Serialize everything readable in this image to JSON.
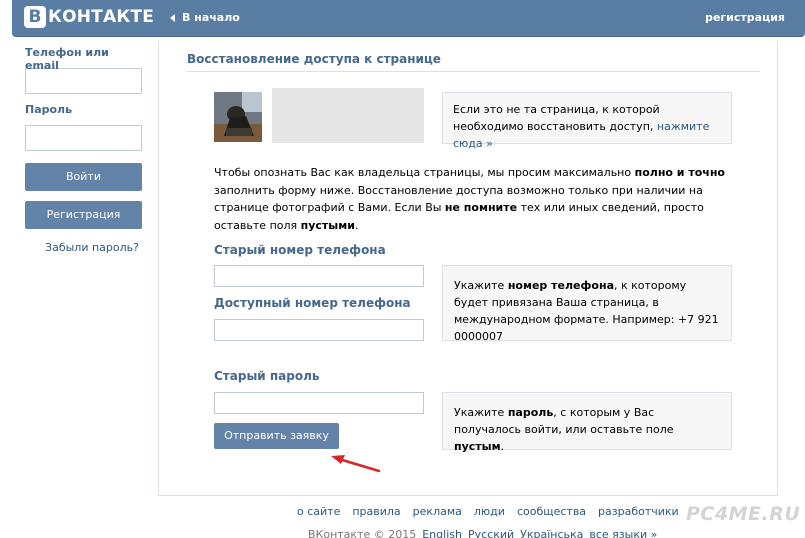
{
  "header": {
    "logo_letter": "В",
    "logo_text": "КОНТАКТЕ",
    "home_link": "В начало",
    "register_link": "регистрация"
  },
  "sidebar": {
    "login_label": "Телефон или email",
    "login_value": "",
    "password_label": "Пароль",
    "password_value": "",
    "login_button": "Войти",
    "register_button": "Регистрация",
    "forgot_link": "Забыли пароль?"
  },
  "main": {
    "title": "Восстановление доступа к странице",
    "not_your_page": {
      "text": "Если это не та страница, к которой необходимо восстановить доступ, ",
      "link": "нажмите сюда »"
    },
    "description": {
      "part1": "Чтобы опознать Вас как владельца страницы, мы просим максимально ",
      "bold1": "полно и точно",
      "part2": " заполнить форму ниже. Восстановление доступа возможно только при наличии на странице фотографий с Вами. Если Вы ",
      "bold2": "не помните",
      "part3": " тех или иных сведений, просто оставьте поля ",
      "bold3": "пустыми",
      "part4": "."
    },
    "old_phone_label": "Старый номер телефона",
    "old_phone_value": "",
    "new_phone_label": "Доступный номер телефона",
    "new_phone_value": "",
    "phone_hint": {
      "part1": "Укажите ",
      "bold": "номер телефона",
      "part2": ", к которому будет привязана Ваша страница, в международном формате. Например: +7 921 0000007"
    },
    "old_password_label": "Старый пароль",
    "old_password_value": "",
    "password_hint": {
      "part1": "Укажите ",
      "bold1": "пароль",
      "part2": ", с которым у Вас получалось войти, или оставьте поле ",
      "bold2": "пустым",
      "part3": "."
    },
    "submit_button": "Отправить заявку"
  },
  "footer": {
    "links": [
      "о сайте",
      "правила",
      "реклама",
      "люди",
      "сообщества",
      "разработчики"
    ],
    "copyright": "ВКонтакте © 2015",
    "languages": [
      "English",
      "Русский",
      "Українська",
      "все языки »"
    ]
  },
  "watermark": "PC4ME.RU",
  "colors": {
    "header_bg": "#597da3",
    "button_bg": "#6383a8",
    "label": "#45688e",
    "link": "#2b587a",
    "arrow": "#d8272b"
  }
}
